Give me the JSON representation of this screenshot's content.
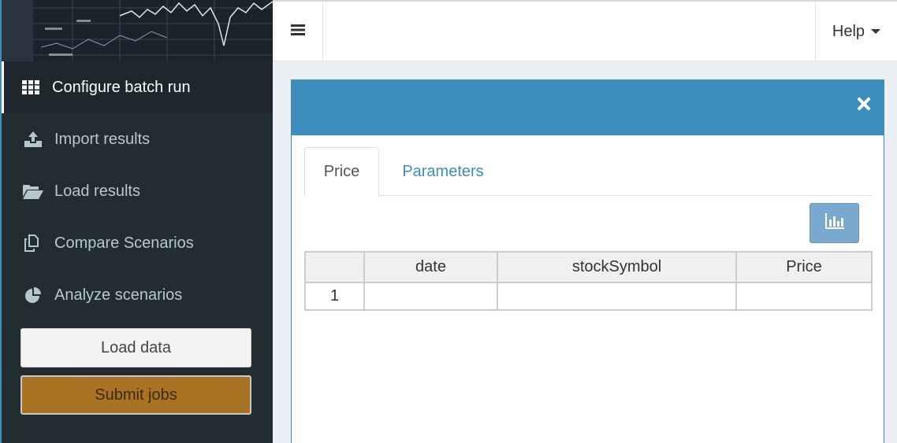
{
  "sidebar": {
    "items": [
      {
        "label": "Configure batch run",
        "icon": "grid-icon",
        "active": true
      },
      {
        "label": "Import results",
        "icon": "upload-icon",
        "active": false
      },
      {
        "label": "Load results",
        "icon": "folder-open-icon",
        "active": false
      },
      {
        "label": "Compare Scenarios",
        "icon": "copy-icon",
        "active": false
      },
      {
        "label": "Analyze scenarios",
        "icon": "pie-chart-icon",
        "active": false
      }
    ],
    "load_data_label": "Load data",
    "submit_jobs_label": "Submit jobs"
  },
  "header": {
    "help_label": "Help"
  },
  "main": {
    "tabs": [
      {
        "label": "Price",
        "active": true
      },
      {
        "label": "Parameters",
        "active": false
      }
    ],
    "table": {
      "columns": [
        "",
        "date",
        "stockSymbol",
        "Price"
      ],
      "rows": [
        [
          "1",
          "",
          "",
          ""
        ]
      ]
    }
  },
  "colors": {
    "sidebar_bg": "#222d32",
    "accent": "#3c8dbc",
    "submit_button": "#a97122"
  }
}
